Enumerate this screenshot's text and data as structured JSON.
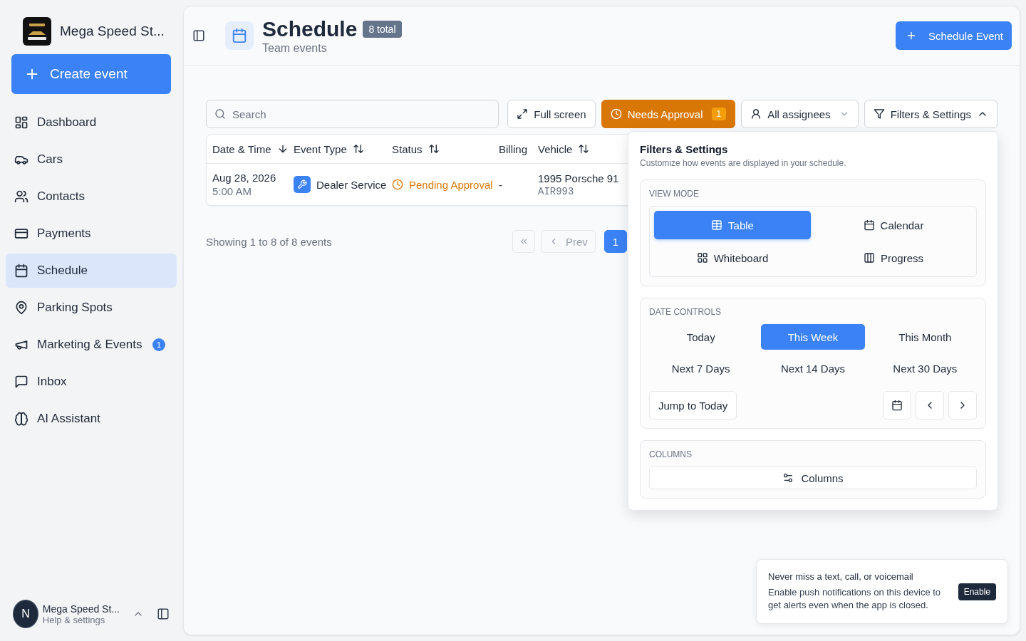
{
  "sidebar": {
    "brand": "Mega Speed St...",
    "create_button": "Create event",
    "items": [
      {
        "label": "Dashboard",
        "selected": false
      },
      {
        "label": "Cars",
        "selected": false
      },
      {
        "label": "Contacts",
        "selected": false
      },
      {
        "label": "Payments",
        "selected": false
      },
      {
        "label": "Schedule",
        "selected": true
      },
      {
        "label": "Parking Spots",
        "selected": false
      },
      {
        "label": "Marketing & Events",
        "selected": false,
        "badge": "1"
      },
      {
        "label": "Inbox",
        "selected": false
      },
      {
        "label": "AI Assistant",
        "selected": false
      }
    ],
    "account": {
      "initial": "N",
      "name": "Mega Speed St...",
      "subtitle": "Help & settings"
    }
  },
  "header": {
    "title": "Schedule",
    "count": "8 total",
    "subtitle": "Team events",
    "action": "Schedule Event"
  },
  "toolbar": {
    "search_placeholder": "Search",
    "fullscreen": "Full screen",
    "approval": {
      "label": "Needs Approval",
      "count": "1"
    },
    "assignees": "All assignees",
    "filters": {
      "label": "Filters & Settings",
      "expanded": true
    }
  },
  "table": {
    "columns": [
      {
        "label": "Date & Time",
        "kind": "sorted"
      },
      {
        "label": "Event Type",
        "kind": "sortable"
      },
      {
        "label": "Status",
        "kind": "sortable"
      },
      {
        "label": "Billing",
        "kind": "plain"
      },
      {
        "label": "Vehicle",
        "kind": "sortable"
      }
    ],
    "rows": [
      {
        "date": "Aug 28, 2026",
        "time": "5:00 AM",
        "event_type": "Dealer Service",
        "status": "Pending Approval",
        "billing": "-",
        "vehicle": "1995 Porsche 91",
        "plate": "AIR993"
      }
    ]
  },
  "pagination": {
    "summary": "Showing 1 to 8 of 8 events",
    "prev": "Prev",
    "pages": [
      {
        "label": "1",
        "selected": true
      }
    ]
  },
  "filters_panel": {
    "title": "Filters & Settings",
    "subtitle": "Customize how events are displayed in your schedule.",
    "view_mode": {
      "heading": "VIEW MODE",
      "options": [
        {
          "label": "Table",
          "selected": true
        },
        {
          "label": "Calendar",
          "selected": false
        },
        {
          "label": "Whiteboard",
          "selected": false
        },
        {
          "label": "Progress",
          "selected": false
        }
      ]
    },
    "date_controls": {
      "heading": "DATE CONTROLS",
      "options": [
        {
          "label": "Today",
          "selected": false
        },
        {
          "label": "This Week",
          "selected": true
        },
        {
          "label": "This Month",
          "selected": false
        },
        {
          "label": "Next 7 Days",
          "selected": false
        },
        {
          "label": "Next 14 Days",
          "selected": false
        },
        {
          "label": "Next 30 Days",
          "selected": false
        }
      ],
      "jump": "Jump to Today"
    },
    "columns": {
      "heading": "COLUMNS",
      "button": "Columns"
    }
  },
  "notification": {
    "title": "Never miss a text, call, or voicemail",
    "body": "Enable push notifications on this device to get alerts even when the app is closed.",
    "action": "Enable"
  }
}
